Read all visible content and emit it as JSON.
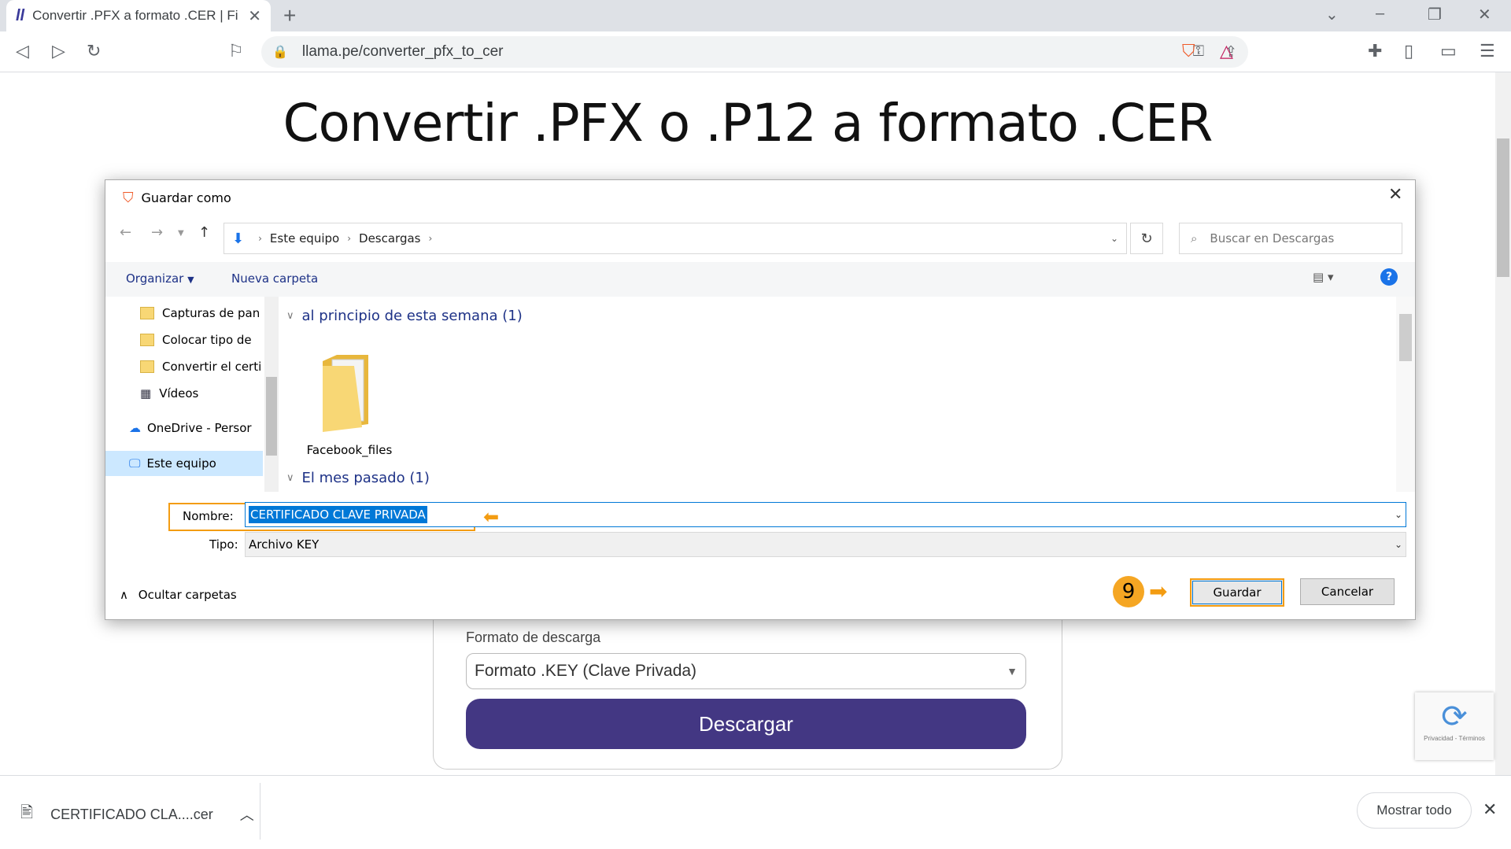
{
  "browser": {
    "tab_title": "Convertir .PFX a formato .CER | Fi",
    "url": "llama.pe/converter_pfx_to_cer"
  },
  "page": {
    "title": "Convertir .PFX o .P12 a formato .CER",
    "format_label": "Formato de descarga",
    "format_value": "Formato .KEY (Clave Privada)",
    "download_button": "Descargar",
    "recaptcha_text": "Privacidad - Términos"
  },
  "download_bar": {
    "file": "CERTIFICADO CLA....cer",
    "show_all": "Mostrar todo"
  },
  "dialog": {
    "title": "Guardar como",
    "breadcrumb": [
      "Este equipo",
      "Descargas"
    ],
    "search_placeholder": "Buscar en Descargas",
    "organize": "Organizar",
    "new_folder": "Nueva carpeta",
    "nav_items": [
      "Capturas de pan",
      "Colocar tipo de",
      "Convertir el certi",
      "Vídeos",
      "OneDrive - Persor",
      "Este equipo"
    ],
    "groups": [
      "al principio de esta semana (1)",
      "El mes pasado (1)"
    ],
    "folder_name": "Facebook_files",
    "name_label": "Nombre:",
    "name_value": "CERTIFICADO CLAVE PRIVADA",
    "type_label": "Tipo:",
    "type_value": "Archivo KEY",
    "hide_folders": "Ocultar carpetas",
    "save": "Guardar",
    "cancel": "Cancelar",
    "step_number": "9"
  }
}
